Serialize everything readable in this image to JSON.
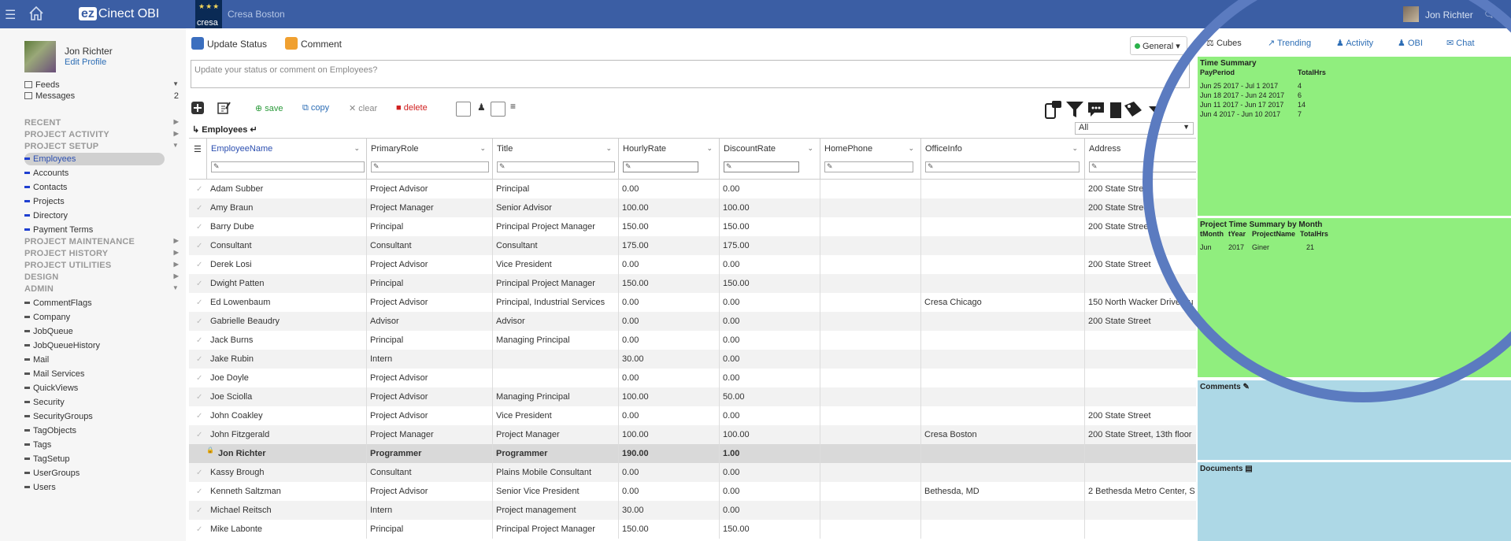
{
  "topbar": {
    "app_name": "Cinect OBI",
    "app_prefix": "ez",
    "org_logo_text": "cresa",
    "org_name": "Cresa Boston",
    "user_name": "Jon Richter"
  },
  "sidebar": {
    "profile_name": "Jon Richter",
    "edit_profile": "Edit Profile",
    "feeds_label": "Feeds",
    "messages_label": "Messages",
    "messages_count": "2",
    "sections": {
      "recent": "RECENT",
      "project_activity": "PROJECT ACTIVITY",
      "project_setup": "PROJECT SETUP",
      "project_maintenance": "PROJECT MAINTENANCE",
      "project_history": "PROJECT HISTORY",
      "project_utilities": "PROJECT UTILITIES",
      "design": "DESIGN",
      "admin": "ADMIN"
    },
    "setup_items": [
      "Employees",
      "Accounts",
      "Contacts",
      "Projects",
      "Directory",
      "Payment Terms"
    ],
    "admin_items": [
      "CommentFlags",
      "Company",
      "JobQueue",
      "JobQueueHistory",
      "Mail",
      "Mail Services",
      "QuickViews",
      "Security",
      "SecurityGroups",
      "TagObjects",
      "Tags",
      "TagSetup",
      "UserGroups",
      "Users"
    ]
  },
  "status": {
    "update_status": "Update Status",
    "comment": "Comment",
    "general": "General",
    "placeholder": "Update your status or comment on Employees?"
  },
  "toolbar": {
    "save": "save",
    "copy": "copy",
    "clear": "clear",
    "delete": "delete"
  },
  "grid": {
    "title": "Employees",
    "filter_value": "All",
    "columns": [
      "EmployeeName",
      "PrimaryRole",
      "Title",
      "HourlyRate",
      "DiscountRate",
      "HomePhone",
      "OfficeInfo",
      "Address"
    ],
    "rows": [
      [
        "Adam Subber",
        "Project Advisor",
        "Principal",
        "0.00",
        "0.00",
        "",
        "",
        "200 State Street"
      ],
      [
        "Amy Braun",
        "Project Manager",
        "Senior Advisor",
        "100.00",
        "100.00",
        "",
        "",
        "200 State Street"
      ],
      [
        "Barry Dube",
        "Principal",
        "Principal Project Manager",
        "150.00",
        "150.00",
        "",
        "",
        "200 State Street"
      ],
      [
        "Consultant",
        "Consultant",
        "Consultant",
        "175.00",
        "175.00",
        "",
        "",
        ""
      ],
      [
        "Derek Losi",
        "Project Advisor",
        "Vice President",
        "0.00",
        "0.00",
        "",
        "",
        "200 State Street"
      ],
      [
        "Dwight Patten",
        "Principal",
        "Principal Project Manager",
        "150.00",
        "150.00",
        "",
        "",
        ""
      ],
      [
        "Ed Lowenbaum",
        "Project Advisor",
        "Principal, Industrial Services",
        "0.00",
        "0.00",
        "",
        "Cresa Chicago",
        "150 North Wacker Drive Su"
      ],
      [
        "Gabrielle Beaudry",
        "Advisor",
        "Advisor",
        "0.00",
        "0.00",
        "",
        "",
        "200 State Street"
      ],
      [
        "Jack Burns",
        "Principal",
        "Managing Principal",
        "0.00",
        "0.00",
        "",
        "",
        ""
      ],
      [
        "Jake Rubin",
        "Intern",
        "",
        "30.00",
        "0.00",
        "",
        "",
        ""
      ],
      [
        "Joe Doyle",
        "Project Advisor",
        "",
        "0.00",
        "0.00",
        "",
        "",
        ""
      ],
      [
        "Joe Sciolla",
        "Project Advisor",
        "Managing Principal",
        "100.00",
        "50.00",
        "",
        "",
        ""
      ],
      [
        "John Coakley",
        "Project Advisor",
        "Vice President",
        "0.00",
        "0.00",
        "",
        "",
        "200 State Street"
      ],
      [
        "John Fitzgerald",
        "Project Manager",
        "Project Manager",
        "100.00",
        "100.00",
        "",
        "Cresa Boston",
        "200 State Street, 13th floor"
      ],
      [
        "Jon Richter",
        "Programmer",
        "Programmer",
        "190.00",
        "1.00",
        "",
        "",
        ""
      ],
      [
        "Kassy Brough",
        "Consultant",
        "Plains Mobile Consultant",
        "0.00",
        "0.00",
        "",
        "",
        ""
      ],
      [
        "Kenneth Saltzman",
        "Project Advisor",
        "Senior Vice President",
        "0.00",
        "0.00",
        "",
        "Bethesda, MD",
        "2 Bethesda Metro Center, S"
      ],
      [
        "Michael Reitsch",
        "Intern",
        "Project management",
        "30.00",
        "0.00",
        "",
        "",
        ""
      ],
      [
        "Mike Labonte",
        "Principal",
        "Principal Project Manager",
        "150.00",
        "150.00",
        "",
        "",
        ""
      ]
    ]
  },
  "right": {
    "tabs": [
      "Cubes",
      "Trending",
      "Activity",
      "OBI",
      "Chat"
    ],
    "time_summary": {
      "title": "Time Summary",
      "headers": [
        "PayPeriod",
        "TotalHrs"
      ],
      "rows": [
        [
          "Jun 25 2017 - Jul 1 2017",
          "4"
        ],
        [
          "Jun 18 2017 - Jun 24 2017",
          "6"
        ],
        [
          "Jun 11 2017 - Jun 17 2017",
          "14"
        ],
        [
          "Jun 4 2017 - Jun 10 2017",
          "7"
        ]
      ]
    },
    "project_summary": {
      "title": "Project Time Summary by Month",
      "headers": [
        "tMonth",
        "tYear",
        "ProjectName",
        "TotalHrs"
      ],
      "rows": [
        [
          "Jun",
          "2017",
          "Giner",
          "21"
        ]
      ]
    },
    "comments_title": "Comments",
    "documents_title": "Documents"
  },
  "colors": {
    "topbar": "#3b5ea4",
    "green_panel": "#90ee7e",
    "blue_panel": "#add8e6",
    "circle": "#5b7bc0",
    "link": "#2c6db5"
  }
}
